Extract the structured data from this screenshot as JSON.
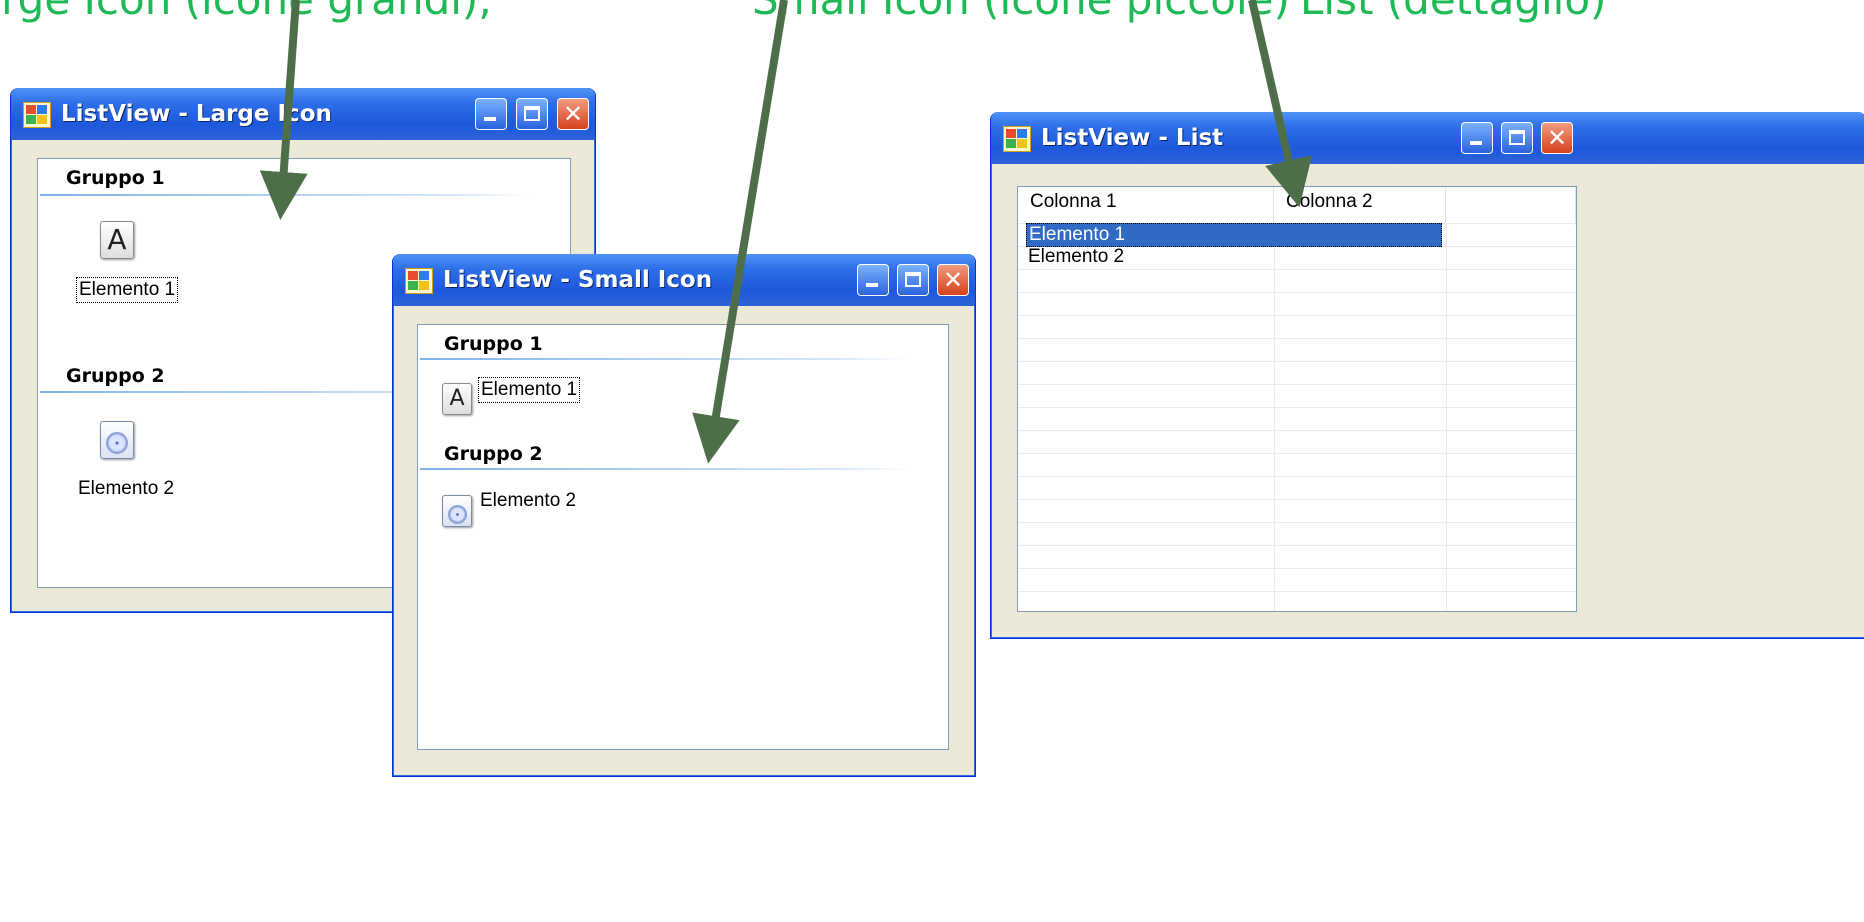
{
  "caption": {
    "segment_1": "Large Icon (icone grandi),",
    "segment_2": "Small Icon (icone piccole)",
    "segment_3": "List (dettaglio)"
  },
  "colors": {
    "caption": "#1db954",
    "arrow": "#4e6e4a",
    "titlebar": "#2d6ee8",
    "selection": "#316ac5"
  },
  "window_large": {
    "title": "ListView - Large Icon",
    "groups": [
      {
        "header": "Gruppo 1",
        "item": {
          "label": "Elemento 1",
          "icon": "font-a-icon",
          "focused": true
        }
      },
      {
        "header": "Gruppo 2",
        "item": {
          "label": "Elemento 2",
          "icon": "cd-disc-icon"
        }
      }
    ]
  },
  "window_small": {
    "title": "ListView - Small Icon",
    "groups": [
      {
        "header": "Gruppo 1",
        "item": {
          "label": "Elemento 1",
          "icon": "font-a-icon",
          "focused": true
        }
      },
      {
        "header": "Gruppo 2",
        "item": {
          "label": "Elemento 2",
          "icon": "cd-disc-icon"
        }
      }
    ]
  },
  "window_list": {
    "title": "ListView - List",
    "columns": [
      "Colonna 1",
      "Colonna 2"
    ],
    "rows": [
      {
        "label": "Elemento 1",
        "selected": true
      },
      {
        "label": "Elemento 2",
        "selected": false
      }
    ]
  },
  "icons": {
    "minimize": "minimize-icon",
    "maximize": "maximize-icon",
    "close": "close-icon",
    "app": "app-icon",
    "arrow": "arrow-icon"
  },
  "glyphs": {
    "a_glyph": "A",
    "close_glyph": "✕"
  }
}
